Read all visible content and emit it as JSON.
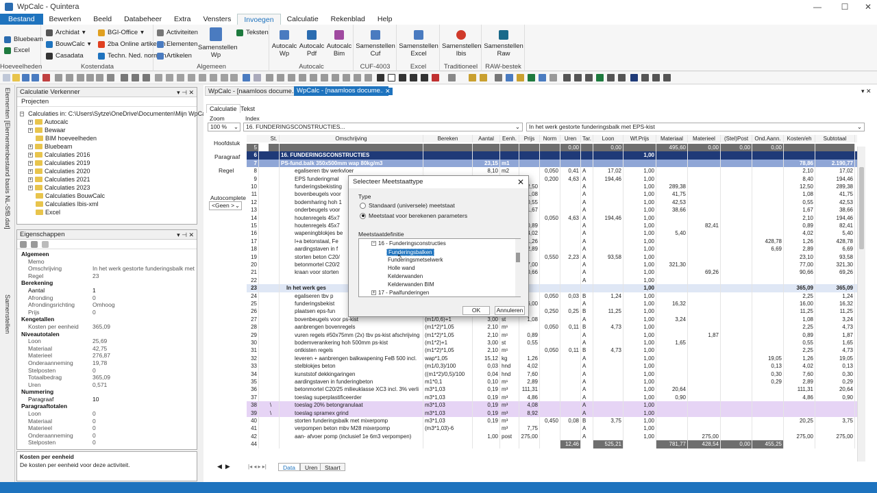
{
  "window": {
    "title": "WpCalc - Quintera"
  },
  "menu": [
    "Bestand",
    "Bewerken",
    "Beeld",
    "Databeheer",
    "Extra",
    "Vensters",
    "Invoegen",
    "Calculatie",
    "Rekenblad",
    "Help"
  ],
  "ribbon": {
    "hoeveelheden": {
      "label": "Hoeveelheden",
      "items": [
        "Bluebeam",
        "Excel"
      ]
    },
    "kostendata": {
      "label": "Kostendata",
      "items": [
        "Archidat",
        "BGI-Office",
        "BouwCalc",
        "2ba Online artikelen",
        "Casadata",
        "Techn. Ned. normen"
      ]
    },
    "algemeen": {
      "label": "Algemeen",
      "items": [
        "Activiteiten",
        "Elementen",
        "Artikelen",
        "Teksten"
      ],
      "big": "Samenstellen Wp"
    },
    "autocalc": {
      "label": "Autocalc",
      "buttons": [
        "Autocalc Wp",
        "Autocalc Pdf",
        "Autocalc Bim"
      ]
    },
    "cuf": {
      "label": "CUF-4003",
      "button": "Samenstellen Cuf"
    },
    "excel": {
      "label": "Excel",
      "button": "Samenstellen Excel"
    },
    "traditioneel": {
      "label": "Traditioneel",
      "button": "Samenstellen Ibis"
    },
    "raw": {
      "label": "RAW-bestek",
      "button": "Samenstellen Raw"
    }
  },
  "sidebar_tabs": [
    "Elementen [Elementenbestand basis NL-SfB.dat]",
    "Samenstellen"
  ],
  "explorer": {
    "title": "Calculatie Verkenner",
    "tab": "Projecten",
    "root": "Calculaties in: C:\\Users\\Sytze\\OneDrive\\Documenten\\Mijn WpCalc\\C",
    "items": [
      "Autocalc",
      "Bewaar",
      "BIM hoeveelheden",
      "Bluebeam",
      "Calculaties 2016",
      "Calculaties 2019",
      "Calculaties 2020",
      "Calculaties 2021",
      "Calculaties 2023",
      "Calculaties BouwCalc",
      "Calculaties Ibis-xml",
      "Excel"
    ]
  },
  "properties": {
    "title": "Eigenschappen",
    "rows": [
      {
        "k": "Algemeen",
        "cat": true
      },
      {
        "k": "Memo",
        "v": ""
      },
      {
        "k": "Omschrijving",
        "v": "In het werk gestorte funderingsbalk met"
      },
      {
        "k": "Regel",
        "v": "23"
      },
      {
        "k": "Berekening",
        "cat": true
      },
      {
        "k": "Aantal",
        "v": "1",
        "b": true
      },
      {
        "k": "Afronding",
        "v": "0"
      },
      {
        "k": "Afrondingsrichting",
        "v": "Omhoog"
      },
      {
        "k": "Prijs",
        "v": "0"
      },
      {
        "k": "Kengetallen",
        "cat": true
      },
      {
        "k": "Kosten per eenheid",
        "v": "365,09"
      },
      {
        "k": "Niveautotalen",
        "cat": true
      },
      {
        "k": "Loon",
        "v": "25,69"
      },
      {
        "k": "Materiaal",
        "v": "42,75"
      },
      {
        "k": "Materieel",
        "v": "276,87"
      },
      {
        "k": "Onderaanneming",
        "v": "19,78"
      },
      {
        "k": "Stelposten",
        "v": "0"
      },
      {
        "k": "Totaalbedrag",
        "v": "365,09"
      },
      {
        "k": "Uren",
        "v": "0,571"
      },
      {
        "k": "Nummering",
        "cat": true
      },
      {
        "k": "Paragraaf",
        "v": "10",
        "b": true
      },
      {
        "k": "Paragraaftotalen",
        "cat": true
      },
      {
        "k": "Loon",
        "v": "0"
      },
      {
        "k": "Materiaal",
        "v": "0"
      },
      {
        "k": "Materieel",
        "v": "0"
      },
      {
        "k": "Onderaanneming",
        "v": "0"
      },
      {
        "k": "Stelposten",
        "v": "0"
      }
    ],
    "help_title": "Kosten per eenheid",
    "help_text": "De kosten per eenheid voor deze activiteit."
  },
  "doc_tabs": [
    "WpCalc - [naamloos docume...",
    "WpCalc - [naamloos docume..."
  ],
  "sheet_tabs": [
    "Calculatie",
    "Tekst"
  ],
  "zoom_label": "Zoom",
  "zoom_value": "100 %",
  "index_label": "Index",
  "index_value": "16. FUNDERINGSCONSTRUCTIES...",
  "desc_value": "In het werk gestorte funderingsbalk met EPS-kist",
  "levels": [
    "Hoofdstuk",
    "Paragraaf",
    "Regel"
  ],
  "autocomplete_label": "Autocomplete",
  "autocomplete_value": "<Geen >",
  "columns": [
    "St.",
    "Omschrijving",
    "Bereken",
    "Aantal",
    "Eenh.",
    "Prijs",
    "Norm",
    "Uren",
    "Tar.",
    "Loon",
    "Wf.Prijs",
    "Materiaal",
    "Materieel",
    "(Stel)Post",
    "Ond.Aann.",
    "Kosten/eh",
    "Subtotaal"
  ],
  "rows": [
    [
      "5",
      "",
      "",
      "",
      "",
      "",
      "",
      "",
      "0,00",
      "",
      "0,00",
      "",
      "495,60",
      "0,00",
      "0,00",
      "0,00",
      "",
      ""
    ],
    [
      "6",
      "",
      "16. FUNDERINGSCONSTRUCTIES",
      "",
      "",
      "",
      "",
      "",
      "",
      "",
      "",
      "1,00",
      "",
      "",
      "",
      "",
      "",
      ""
    ],
    [
      "7",
      "",
      "PS-fund.balk 350x500mm wap 80kg/m3",
      "",
      "23,15",
      "m1",
      "",
      "",
      "",
      "",
      "",
      "",
      "",
      "",
      "",
      "",
      "78,86",
      "2.190,77"
    ],
    [
      "8",
      "",
      "egaliseren tbv werkvloer",
      "",
      "8,10",
      "m2",
      "",
      "0,050",
      "0,41",
      "A",
      "17,02",
      "1,00",
      "",
      "",
      "",
      "",
      "2,10",
      "17,02"
    ],
    [
      "9",
      "",
      "EPS funderingmal",
      "",
      "",
      "",
      "",
      "0,200",
      "4,63",
      "A",
      "194,46",
      "1,00",
      "",
      "",
      "",
      "",
      "8,40",
      "194,46"
    ],
    [
      "10",
      "",
      "funderingsbekisting",
      "",
      "",
      "",
      "12,50",
      "",
      "",
      "A",
      "",
      "1,00",
      "289,38",
      "",
      "",
      "",
      "12,50",
      "289,38"
    ],
    [
      "11",
      "",
      "bovenbeugels voor",
      "",
      "",
      "",
      "1,08",
      "",
      "",
      "A",
      "",
      "1,00",
      "41,75",
      "",
      "",
      "",
      "1,08",
      "41,75"
    ],
    [
      "12",
      "",
      "bodemharing hoh 1",
      "",
      "",
      "",
      "0,55",
      "",
      "",
      "A",
      "",
      "1,00",
      "42,53",
      "",
      "",
      "",
      "0,55",
      "42,53"
    ],
    [
      "13",
      "",
      "onderbeugels voor",
      "",
      "",
      "",
      "1,67",
      "",
      "",
      "A",
      "",
      "1,00",
      "38,66",
      "",
      "",
      "",
      "1,67",
      "38,66"
    ],
    [
      "14",
      "",
      "houtenregels 45x7",
      "",
      "",
      "",
      "",
      "0,050",
      "4,63",
      "A",
      "194,46",
      "1,00",
      "",
      "",
      "",
      "",
      "2,10",
      "194,46"
    ],
    [
      "15",
      "",
      "houtenregels 45x7",
      "",
      "",
      "",
      "0,89",
      "",
      "",
      "A",
      "",
      "1,00",
      "",
      "82,41",
      "",
      "",
      "0,89",
      "82,41"
    ],
    [
      "16",
      "",
      "wapeningblokjes be",
      "",
      "",
      "",
      "4,02",
      "",
      "",
      "A",
      "",
      "1,00",
      "5,40",
      "",
      "",
      "",
      "4,02",
      "5,40"
    ],
    [
      "17",
      "",
      "l+a betonstaal, Fe",
      "",
      "",
      "",
      "1,26",
      "",
      "",
      "A",
      "",
      "1,00",
      "",
      "",
      "",
      "428,78",
      "1,26",
      "428,78"
    ],
    [
      "18",
      "",
      "aardingstaven in f",
      "",
      "",
      "",
      "2,89",
      "",
      "",
      "A",
      "",
      "1,00",
      "",
      "",
      "",
      "6,69",
      "2,89",
      "6,69"
    ],
    [
      "19",
      "",
      "storten beton C20/",
      "",
      "",
      "",
      "",
      "0,550",
      "2,23",
      "A",
      "93,58",
      "1,00",
      "",
      "",
      "",
      "",
      "23,10",
      "93,58"
    ],
    [
      "20",
      "",
      "betonmortel C20/2",
      "",
      "",
      "",
      "77,00",
      "",
      "",
      "A",
      "",
      "1,00",
      "321,30",
      "",
      "",
      "",
      "77,00",
      "321,30"
    ],
    [
      "21",
      "",
      "kraan voor storten",
      "",
      "",
      "",
      "90,66",
      "",
      "",
      "A",
      "",
      "1,00",
      "",
      "69,26",
      "",
      "",
      "90,66",
      "69,26"
    ],
    [
      "22",
      "",
      "",
      "",
      "",
      "",
      "",
      "",
      "",
      "A",
      "",
      "1,00",
      "",
      "",
      "",
      "",
      "",
      ""
    ],
    [
      "23",
      "",
      "In het werk ges",
      "",
      "",
      "",
      "",
      "",
      "",
      "",
      "",
      "1,00",
      "",
      "",
      "",
      "",
      "365,09",
      "365,09"
    ],
    [
      "24",
      "",
      "egaliseren tbv p",
      "",
      "",
      "",
      "",
      "0,050",
      "0,03",
      "B",
      "1,24",
      "1,00",
      "",
      "",
      "",
      "",
      "2,25",
      "1,24"
    ],
    [
      "25",
      "",
      "funderingsbekist",
      "",
      "",
      "",
      "16,00",
      "",
      "",
      "A",
      "",
      "1,00",
      "16,32",
      "",
      "",
      "",
      "16,00",
      "16,32"
    ],
    [
      "26",
      "",
      "plaatsen eps-fun",
      "",
      "",
      "",
      "",
      "0,250",
      "0,25",
      "B",
      "11,25",
      "1,00",
      "",
      "",
      "",
      "",
      "11,25",
      "11,25"
    ],
    [
      "27",
      "",
      "bovenbeugels voor ps-kist",
      "(m1/0,6)+1",
      "3,00",
      "st",
      "1,08",
      "",
      "",
      "A",
      "",
      "1,00",
      "3,24",
      "",
      "",
      "",
      "1,08",
      "3,24"
    ],
    [
      "28",
      "",
      "aanbrengen bovenregels",
      "(m1*2)*1,05",
      "2,10",
      "m¹",
      "",
      "0,050",
      "0,11",
      "B",
      "4,73",
      "1,00",
      "",
      "",
      "",
      "",
      "2,25",
      "4,73"
    ],
    [
      "29",
      "",
      "vuren regels #50x75mm (2x) tbv ps-kist afschrijving",
      "(m1*2)*1,05",
      "2,10",
      "m¹",
      "0,89",
      "",
      "",
      "A",
      "",
      "1,00",
      "",
      "1,87",
      "",
      "",
      "0,89",
      "1,87"
    ],
    [
      "30",
      "",
      "bodemverankering hoh 500mm ps-kist",
      "(m1*2)+1",
      "3,00",
      "st",
      "0,55",
      "",
      "",
      "A",
      "",
      "1,00",
      "1,65",
      "",
      "",
      "",
      "0,55",
      "1,65"
    ],
    [
      "31",
      "",
      "ontkisten regels",
      "(m1*2)*1,05",
      "2,10",
      "m¹",
      "",
      "0,050",
      "0,11",
      "B",
      "4,73",
      "1,00",
      "",
      "",
      "",
      "",
      "2,25",
      "4,73"
    ],
    [
      "32",
      "",
      "leveren + aanbrengen balkwapening FeB 500 incl.",
      "wap*1,05",
      "15,12",
      "kg",
      "1,26",
      "",
      "",
      "A",
      "",
      "1,00",
      "",
      "",
      "",
      "19,05",
      "1,26",
      "19,05"
    ],
    [
      "33",
      "",
      "stelblokjes beton",
      "(m1/0,3)/100",
      "0,03",
      "hnd",
      "4,02",
      "",
      "",
      "A",
      "",
      "1,00",
      "",
      "",
      "",
      "0,13",
      "4,02",
      "0,13"
    ],
    [
      "34",
      "",
      "kunststof dekkingaringen",
      "((m1*2)/0,5)/100",
      "0,04",
      "hnd",
      "7,60",
      "",
      "",
      "A",
      "",
      "1,00",
      "",
      "",
      "",
      "0,30",
      "7,60",
      "0,30"
    ],
    [
      "35",
      "",
      "aardingstaven in funderingbeton",
      "m1*0,1",
      "0,10",
      "m¹",
      "2,89",
      "",
      "",
      "A",
      "",
      "1,00",
      "",
      "",
      "",
      "0,29",
      "2,89",
      "0,29"
    ],
    [
      "36",
      "",
      "betonmortel C20/25 milieuklasse XC3 incl. 3% verli",
      "m3*1,03",
      "0,19",
      "m³",
      "111,31",
      "",
      "",
      "A",
      "",
      "1,00",
      "20,64",
      "",
      "",
      "",
      "111,31",
      "20,64"
    ],
    [
      "37",
      "",
      "toeslag superplastificeerder",
      "m3*1,03",
      "0,19",
      "m³",
      "4,86",
      "",
      "",
      "A",
      "",
      "1,00",
      "0,90",
      "",
      "",
      "",
      "4,86",
      "0,90"
    ],
    [
      "38",
      "\\",
      "toeslag 20% betongranulaat",
      "m3*1,03",
      "0,19",
      "m³",
      "4,08",
      "",
      "",
      "A",
      "",
      "1,00",
      "",
      "",
      "",
      "",
      "",
      ""
    ],
    [
      "39",
      "\\",
      "toeslag spramex grind",
      "m3*1,03",
      "0,19",
      "m³",
      "8,92",
      "",
      "",
      "A",
      "",
      "1,00",
      "",
      "",
      "",
      "",
      "",
      ""
    ],
    [
      "40",
      "",
      "storten funderingsbalk met mixerpomp",
      "m3*1,03",
      "0,19",
      "m³",
      "",
      "0,450",
      "0,08",
      "B",
      "3,75",
      "1,00",
      "",
      "",
      "",
      "",
      "20,25",
      "3,75"
    ],
    [
      "41",
      "",
      "verpompen beton mbv M28 mixerpomp",
      "(m3*1,03)-6",
      "",
      "m³",
      "7,75",
      "",
      "",
      "A",
      "",
      "1,00",
      "",
      "",
      "",
      "",
      "",
      ""
    ],
    [
      "42",
      "",
      "aan- afvoer pomp (inclusief 1e 6m3 verpompen)",
      "",
      "1,00",
      "post",
      "275,00",
      "",
      "",
      "A",
      "",
      "1,00",
      "",
      "275,00",
      "",
      "",
      "275,00",
      "275,00"
    ],
    [
      "44",
      "",
      "",
      "",
      "",
      "",
      "",
      "",
      "12,46",
      "",
      "525,21",
      "",
      "781,77",
      "428,54",
      "0,00",
      "455,25",
      "",
      ""
    ]
  ],
  "bottom_tabs": [
    "Data",
    "Uren",
    "Staart"
  ],
  "dialog": {
    "title": "Selecteer Meetstaattype",
    "type_label": "Type",
    "opt1": "Standaard (universele) meetstaat",
    "opt2": "Meetstaat voor berekenen parameters",
    "def_label": "Meetstaatdefinitie",
    "tree_root": "16 - Funderingsconstructies",
    "tree_items": [
      "Funderingsbalken",
      "Funderingsmetselwerk",
      "Holle wand",
      "Kelderwanden",
      "Kelderwanden BIM"
    ],
    "tree_next": "17 - Paalfunderingen",
    "ok": "OK",
    "cancel": "Annuleren"
  },
  "colors": {
    "accent": "#1e73be",
    "chapter_row": "#1f3a78",
    "paragraph_row": "#8fa6d6",
    "purple_row": "#e6d4f5"
  }
}
